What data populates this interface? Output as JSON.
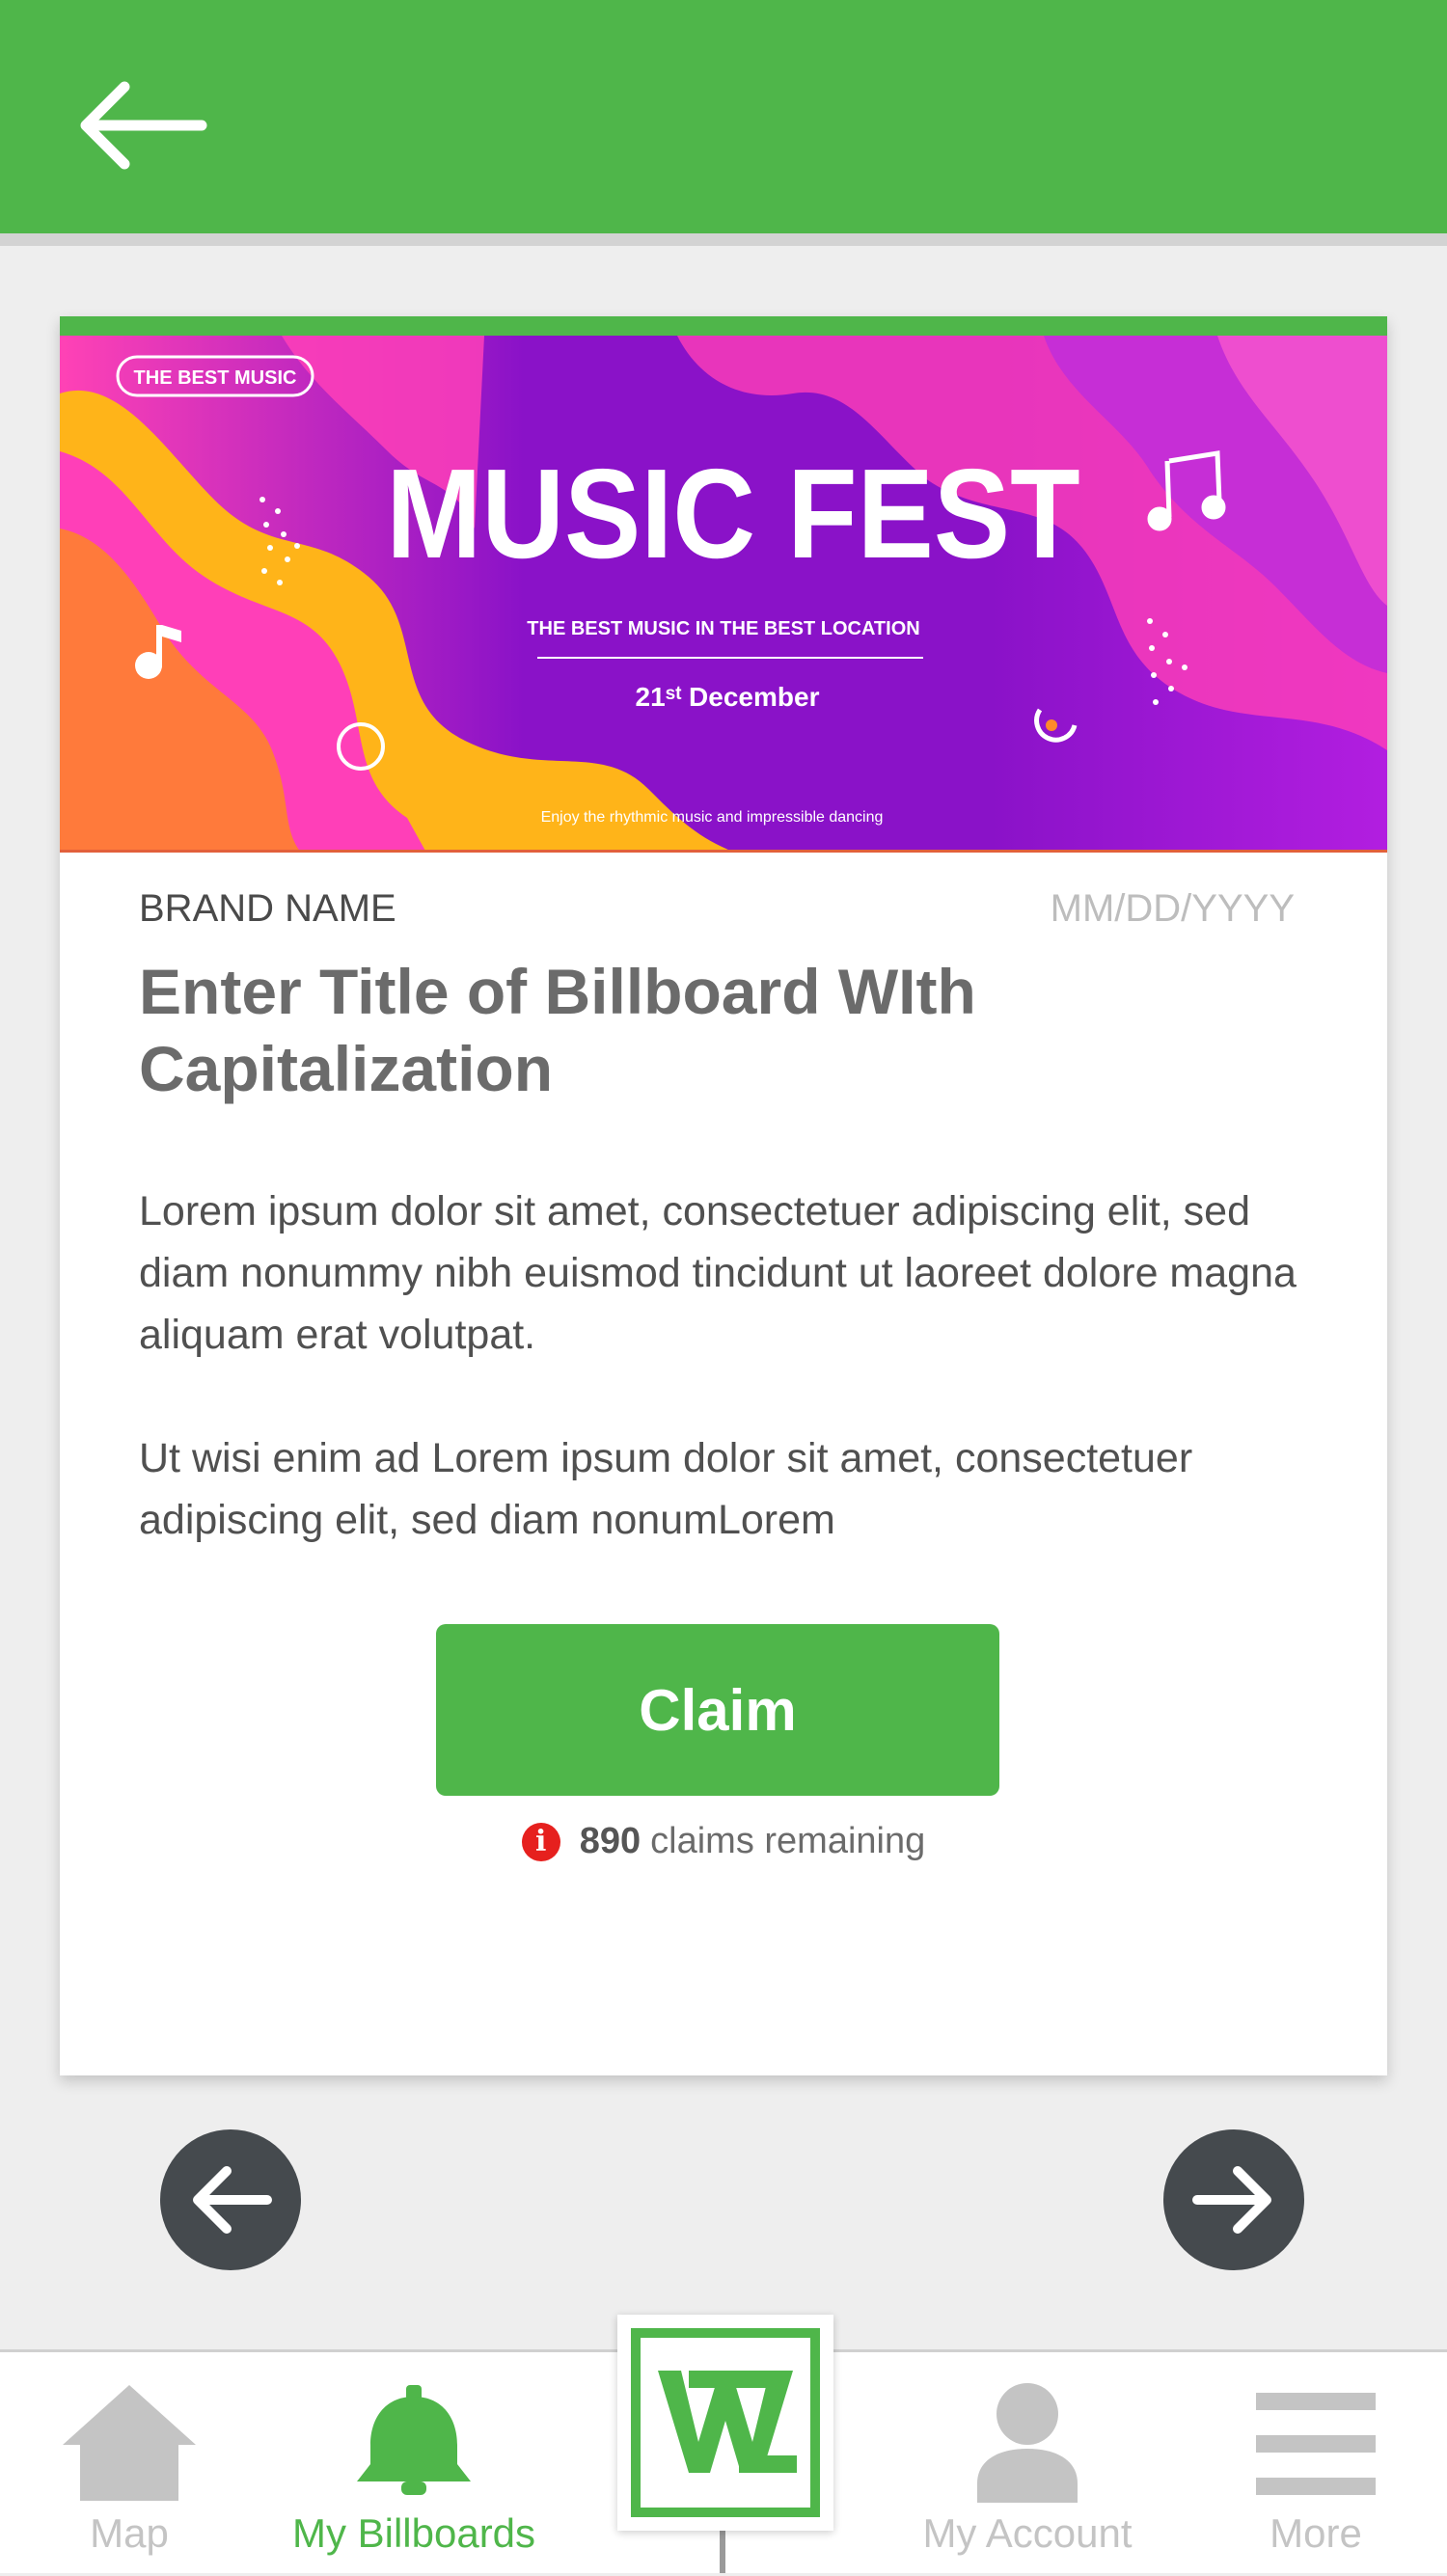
{
  "header": {
    "back_icon": "arrow-left-icon",
    "accent_color": "#4fb64a"
  },
  "billboard": {
    "banner": {
      "tag": "THE BEST MUSIC",
      "headline": "MUSIC FEST",
      "subheadline": "THE BEST MUSIC IN THE BEST LOCATION",
      "date": "21ˢᵗ December",
      "footer": "Enjoy the rhythmic music and impressible dancing",
      "colors": [
        "#8a12c8",
        "#ff3fb8",
        "#ffb419"
      ]
    },
    "brand": "BRAND NAME",
    "date_placeholder": "MM/DD/YYYY",
    "title": "Enter Title of Billboard WIth Capitalization",
    "paragraphs": [
      "Lorem ipsum dolor sit amet, consectetuer adipiscing elit, sed diam nonummy nibh euismod tincidunt ut laoreet dolore magna aliquam erat volutpat.",
      "Ut wisi enim ad Lorem ipsum dolor sit amet, consectetuer adipiscing elit, sed diam nonumLorem"
    ],
    "claim_label": "Claim",
    "claims_count": "890",
    "claims_text": "claims remaining",
    "alert_icon": "info-alert-icon"
  },
  "pager": {
    "prev_icon": "arrow-left-circle-icon",
    "next_icon": "arrow-right-circle-icon"
  },
  "tabbar": {
    "items": [
      {
        "label": "Map",
        "icon": "home-icon",
        "active": false
      },
      {
        "label": "My Billboards",
        "icon": "bell-icon",
        "active": true
      },
      {
        "label": "",
        "icon": "w-logo-icon",
        "active": false
      },
      {
        "label": "My Account",
        "icon": "person-icon",
        "active": false
      },
      {
        "label": "More",
        "icon": "menu-icon",
        "active": false
      }
    ],
    "logo_letter": "W"
  }
}
